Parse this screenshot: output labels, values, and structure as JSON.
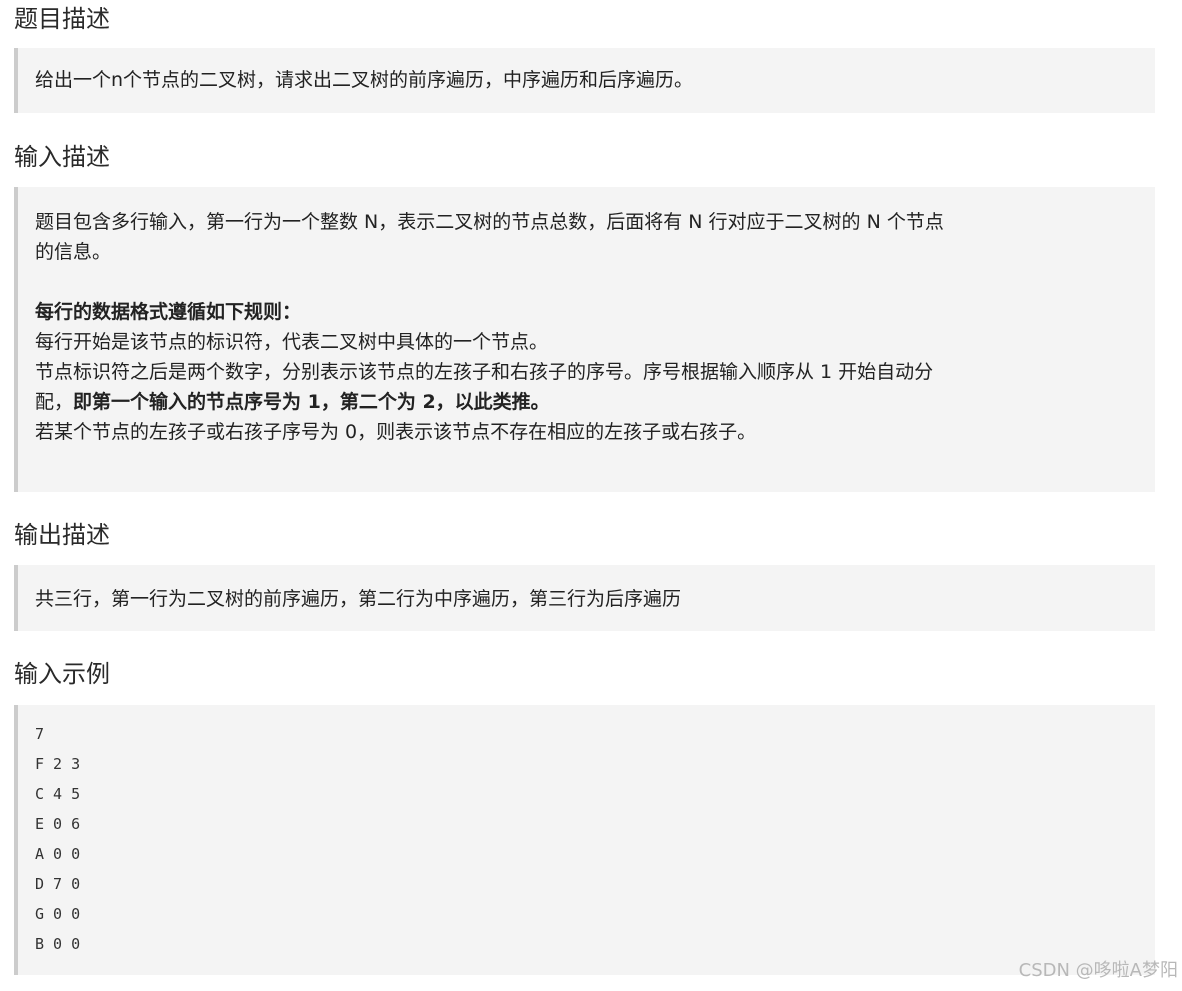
{
  "problem": {
    "heading": "题目描述",
    "text": "给出一个n个节点的二叉树，请求出二叉树的前序遍历，中序遍历和后序遍历。"
  },
  "input_desc": {
    "heading": "输入描述",
    "para1_line1": "题目包含多行输入，第一行为一个整数 N，表示二叉树的节点总数，后面将有 N 行对应于二叉树的 N 个节点",
    "para1_line2": "的信息。",
    "rules_title": "每行的数据格式遵循如下规则：",
    "rule1": "每行开始是该节点的标识符，代表二叉树中具体的一个节点。",
    "rule2_line1": "节点标识符之后是两个数字，分别表示该节点的左孩子和右孩子的序号。序号根据输入顺序从 1 开始自动分",
    "rule2_line2_prefix": "配，",
    "rule2_line2_bold": "即第一个输入的节点序号为 1，第二个为 2，以此类推。",
    "rule3": "若某个节点的左孩子或右孩子序号为 0，则表示该节点不存在相应的左孩子或右孩子。"
  },
  "output_desc": {
    "heading": "输出描述",
    "text": "共三行，第一行为二叉树的前序遍历，第二行为中序遍历，第三行为后序遍历"
  },
  "sample_input": {
    "heading": "输入示例",
    "lines": [
      "7",
      "F 2 3",
      "C 4 5",
      "E 0 6",
      "A 0 0",
      "D 7 0",
      "G 0 0",
      "B 0 0"
    ]
  },
  "watermark": "CSDN @哆啦A梦阳"
}
